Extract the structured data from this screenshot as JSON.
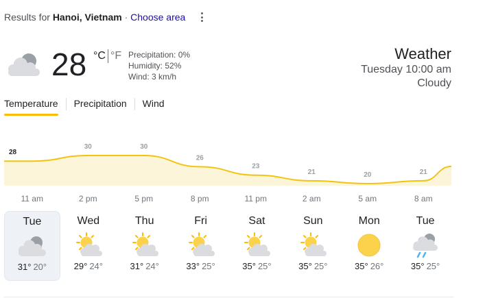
{
  "header": {
    "results_prefix": "Results for",
    "location": "Hanoi, Vietnam",
    "separator": "·",
    "choose_area": "Choose area"
  },
  "current": {
    "temperature": "28",
    "unit_c": "°C",
    "unit_f": "°F",
    "active_unit": "C",
    "precipitation": "Precipitation: 0%",
    "humidity": "Humidity: 52%",
    "wind": "Wind: 3 km/h",
    "icon": "cloudy-icon"
  },
  "summary": {
    "title": "Weather",
    "time": "Tuesday 10:00 am",
    "condition": "Cloudy"
  },
  "tabs": [
    {
      "label": "Temperature",
      "active": true
    },
    {
      "label": "Precipitation",
      "active": false
    },
    {
      "label": "Wind",
      "active": false
    }
  ],
  "chart_data": {
    "type": "area",
    "values": [
      28,
      30,
      30,
      26,
      23,
      21,
      20,
      21
    ],
    "time_labels": [
      "11 am",
      "2 pm",
      "5 pm",
      "8 pm",
      "11 pm",
      "2 am",
      "5 am",
      "8 am"
    ],
    "colors": {
      "line": "#f2c40f",
      "fill": "#fdf5d9",
      "label": "#9aa0a6",
      "current_label": "#202124"
    }
  },
  "days": [
    {
      "name": "Tue",
      "icon": "cloudy-icon",
      "high": "31°",
      "low": "20°",
      "selected": true
    },
    {
      "name": "Wed",
      "icon": "partly-sunny-icon",
      "high": "29°",
      "low": "24°",
      "selected": false
    },
    {
      "name": "Thu",
      "icon": "partly-sunny-icon",
      "high": "31°",
      "low": "24°",
      "selected": false
    },
    {
      "name": "Fri",
      "icon": "partly-sunny-icon",
      "high": "33°",
      "low": "25°",
      "selected": false
    },
    {
      "name": "Sat",
      "icon": "partly-sunny-icon",
      "high": "35°",
      "low": "25°",
      "selected": false
    },
    {
      "name": "Sun",
      "icon": "partly-sunny-icon",
      "high": "35°",
      "low": "25°",
      "selected": false
    },
    {
      "name": "Mon",
      "icon": "sunny-icon",
      "high": "35°",
      "low": "26°",
      "selected": false
    },
    {
      "name": "Tue",
      "icon": "rain-shower-icon",
      "high": "35°",
      "low": "25°",
      "selected": false
    }
  ]
}
